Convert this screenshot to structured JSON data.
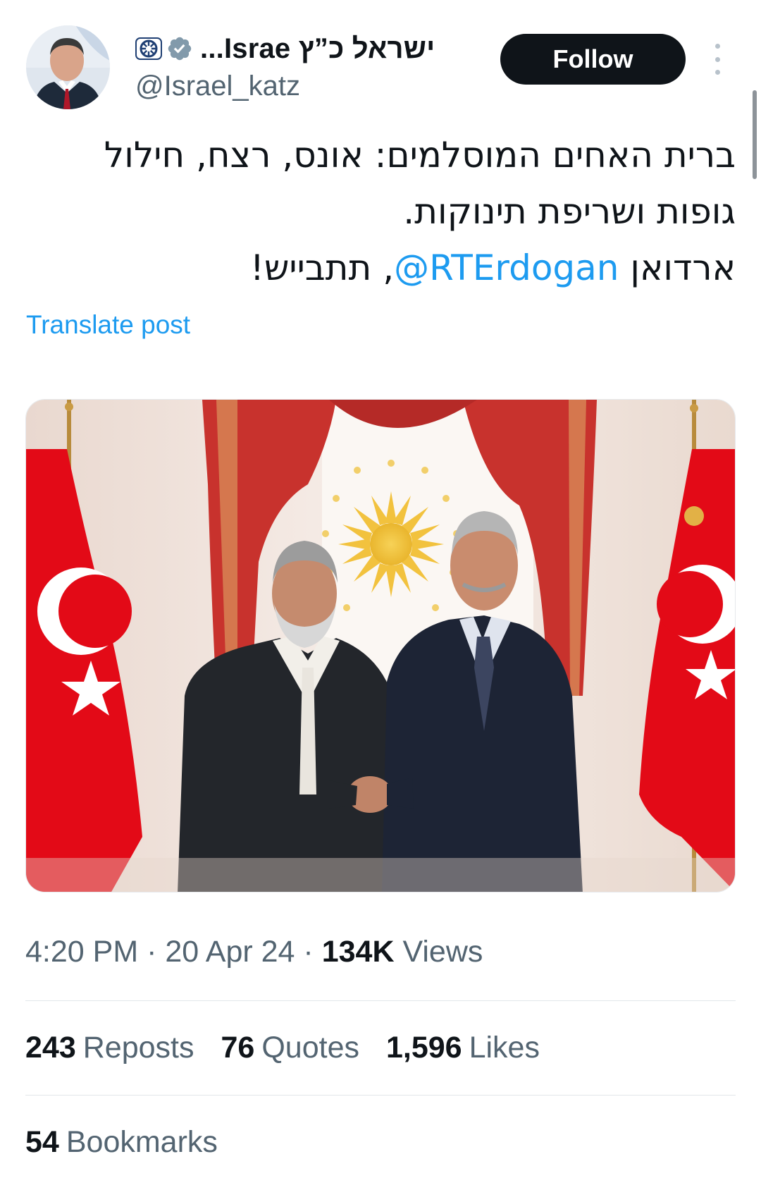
{
  "header": {
    "display_name": "ישראל כ”ץ Israe...",
    "handle": "@Israel_katz",
    "follow_label": "Follow"
  },
  "post": {
    "line1": "ברית האחים המוסלמים: אונס, רצח, חילול",
    "line2": "גופות ושריפת תינוקות.",
    "line3_before": "ארדואן ",
    "mention": "@RTErdogan",
    "line3_after": ", תתבייש!",
    "translate_label": "Translate post"
  },
  "meta": {
    "time": "4:20 PM",
    "sep": "·",
    "date": "20 Apr 24",
    "views_count": "134K",
    "views_label": "Views"
  },
  "stats": {
    "reposts_count": "243",
    "reposts_label": "Reposts",
    "quotes_count": "76",
    "quotes_label": "Quotes",
    "likes_count": "1,596",
    "likes_label": "Likes",
    "bookmarks_count": "54",
    "bookmarks_label": "Bookmarks"
  },
  "icons": {
    "affiliate_badge": "flag-badge-icon",
    "verified_badge": "verified-icon",
    "more": "more-vertical-icon"
  },
  "colors": {
    "accent": "#1d9bf0",
    "follow_bg": "#0f1419",
    "secondary_text": "#536471",
    "verified_gray": "#829aab",
    "flag_red": "#e30a17"
  }
}
